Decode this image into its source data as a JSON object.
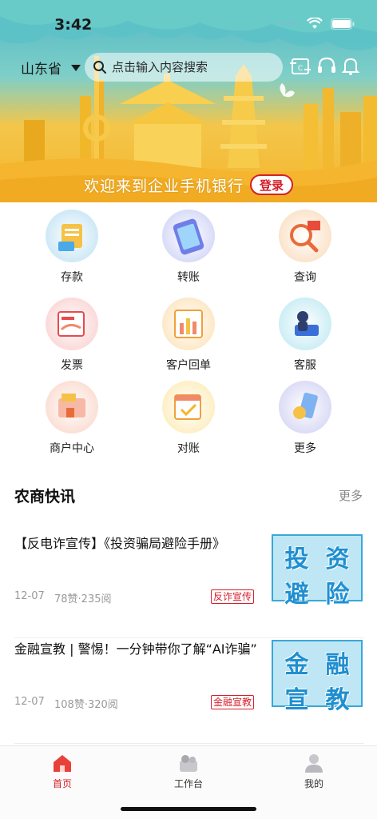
{
  "status": {
    "time": "3:42"
  },
  "header": {
    "province": "山东省",
    "search_placeholder": "点击输入内容搜索",
    "welcome_text": "欢迎来到企业手机银行",
    "login_label": "登录"
  },
  "menu": [
    {
      "label": "存款",
      "icon": "deposit-icon",
      "color": "#cfe9f6"
    },
    {
      "label": "转账",
      "icon": "transfer-icon",
      "color": "#d9dcf8"
    },
    {
      "label": "查询",
      "icon": "query-icon",
      "color": "#fbe4cc"
    },
    {
      "label": "发票",
      "icon": "invoice-icon",
      "color": "#fbdada"
    },
    {
      "label": "客户回单",
      "icon": "receipt-icon",
      "color": "#fde9c8"
    },
    {
      "label": "客服",
      "icon": "customer-service-icon",
      "color": "#cdeef5"
    },
    {
      "label": "商户中心",
      "icon": "merchant-center-icon",
      "color": "#fbe0d6"
    },
    {
      "label": "对账",
      "icon": "reconcile-icon",
      "color": "#fdf0c6"
    },
    {
      "label": "更多",
      "icon": "more-icon",
      "color": "#dcdcf6"
    }
  ],
  "news": {
    "title": "农商快讯",
    "more_label": "更多",
    "articles": [
      {
        "title": "【反电诈宣传】《投资骗局避险手册》",
        "date": "12-07",
        "stats": "78赞·235阅",
        "tag": "反诈宣传",
        "thumb": [
          "投",
          "资",
          "避",
          "险"
        ]
      },
      {
        "title": "金融宣教 | 警惕！一分钟带你了解“AI诈骗”",
        "date": "12-07",
        "stats": "108赞·320阅",
        "tag": "金融宣教",
        "thumb": [
          "金",
          "融",
          "宣",
          "教"
        ]
      }
    ]
  },
  "tabbar": [
    {
      "label": "首页",
      "icon": "home-icon",
      "active": true
    },
    {
      "label": "工作台",
      "icon": "workbench-icon",
      "active": false
    },
    {
      "label": "我的",
      "icon": "profile-icon",
      "active": false
    }
  ],
  "colors": {
    "accent": "#d5202b",
    "banner_top": "#4fb7c4",
    "banner_bottom": "#f5b52e"
  }
}
